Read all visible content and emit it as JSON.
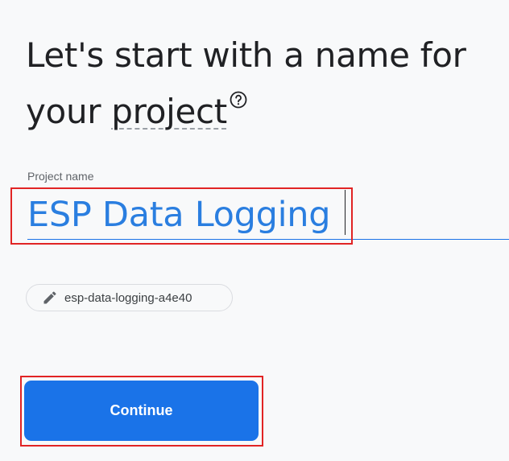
{
  "heading": {
    "line1": "Let's start with a name for",
    "line2_prefix": "your ",
    "line2_underlined": "project"
  },
  "project_name_field": {
    "label": "Project name",
    "value": "ESP Data Logging"
  },
  "project_id_chip": {
    "text": "esp-data-logging-a4e40"
  },
  "continue_button": {
    "label": "Continue"
  },
  "colors": {
    "accent": "#1a73e8",
    "input_text": "#2a7ee0",
    "highlight_box": "#e12424",
    "background": "#f8f9fa"
  },
  "icons": [
    "help-icon",
    "pencil-icon"
  ]
}
